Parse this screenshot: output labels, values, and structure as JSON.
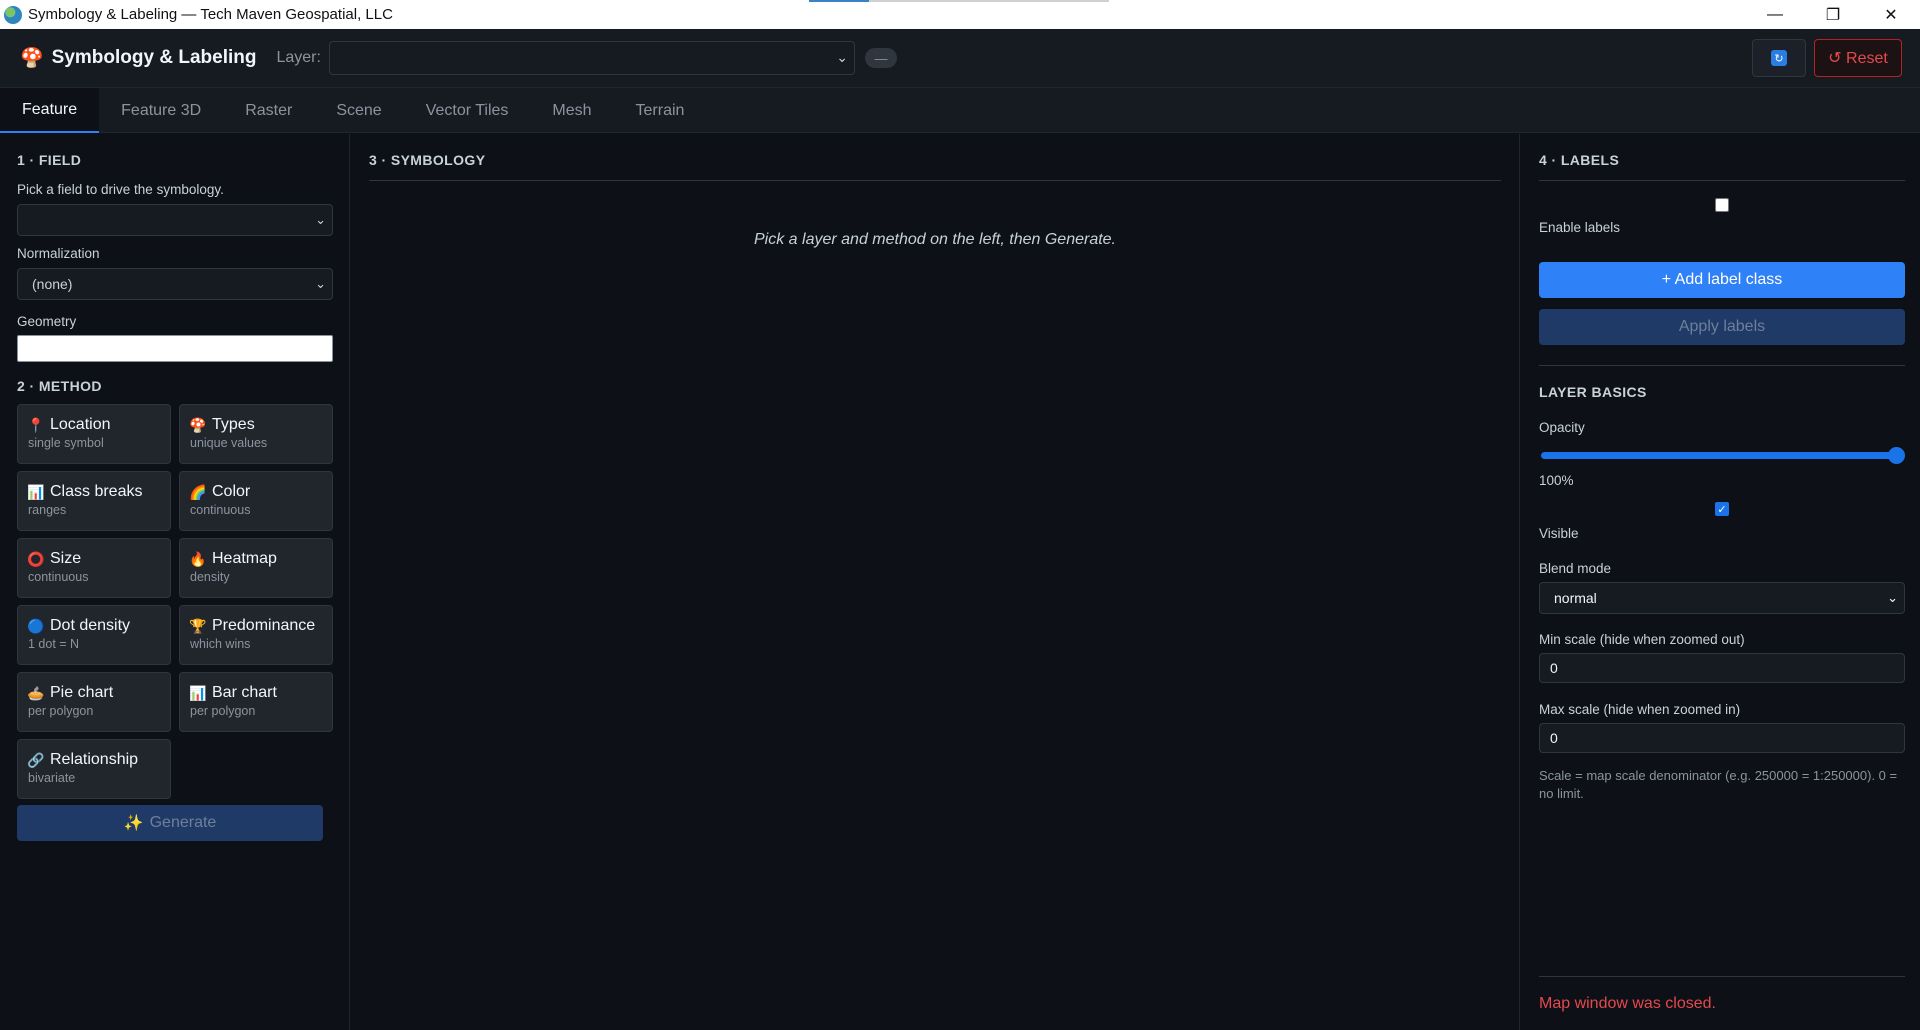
{
  "window": {
    "title": "Symbology & Labeling — Tech Maven Geospatial, LLC",
    "minimize": "—",
    "maximize": "❐",
    "close": "✕"
  },
  "header": {
    "logo": "🍄",
    "title": "Symbology & Labeling",
    "layer_label": "Layer:",
    "layer_value": "",
    "layer_badge": "—",
    "refresh_icon": "↻",
    "reset_label": "↺ Reset"
  },
  "tabs": [
    "Feature",
    "Feature 3D",
    "Raster",
    "Scene",
    "Vector Tiles",
    "Mesh",
    "Terrain"
  ],
  "active_tab": "Feature",
  "left": {
    "field_title": "1 · FIELD",
    "field_hint": "Pick a field to drive the symbology.",
    "field_value": "",
    "normalization_label": "Normalization",
    "normalization_value": "(none)",
    "geometry_label": "Geometry",
    "geometry_value": "",
    "method_title": "2 · METHOD",
    "methods": [
      {
        "icon": "📍",
        "title": "Location",
        "sub": "single symbol"
      },
      {
        "icon": "🍄",
        "title": "Types",
        "sub": "unique values"
      },
      {
        "icon": "📊",
        "title": "Class breaks",
        "sub": "ranges"
      },
      {
        "icon": "🌈",
        "title": "Color",
        "sub": "continuous"
      },
      {
        "icon": "⭕",
        "title": "Size",
        "sub": "continuous"
      },
      {
        "icon": "🔥",
        "title": "Heatmap",
        "sub": "density"
      },
      {
        "icon": "🔵",
        "title": "Dot density",
        "sub": "1 dot = N"
      },
      {
        "icon": "🏆",
        "title": "Predominance",
        "sub": "which wins"
      },
      {
        "icon": "🥧",
        "title": "Pie chart",
        "sub": "per polygon"
      },
      {
        "icon": "📊",
        "title": "Bar chart",
        "sub": "per polygon"
      },
      {
        "icon": "🔗",
        "title": "Relationship",
        "sub": "bivariate"
      }
    ],
    "generate_icon": "✨",
    "generate_label": "Generate"
  },
  "middle": {
    "title": "3 · SYMBOLOGY",
    "placeholder": "Pick a layer and method on the left, then Generate."
  },
  "right": {
    "labels_title": "4 · LABELS",
    "enable_labels": "Enable labels",
    "add_label_class": "+ Add label class",
    "apply_labels": "Apply labels",
    "basics_title": "LAYER BASICS",
    "opacity_label": "Opacity",
    "opacity_value": "100%",
    "opacity_fraction": 1.0,
    "visible_label": "Visible",
    "visible_checked": true,
    "blend_label": "Blend mode",
    "blend_value": "normal",
    "min_scale_label": "Min scale (hide when zoomed out)",
    "min_scale_value": "0",
    "max_scale_label": "Max scale (hide when zoomed in)",
    "max_scale_value": "0",
    "scale_note": "Scale = map scale denominator (e.g. 250000 = 1:250000). 0 = no limit.",
    "status": "Map window was closed."
  },
  "colors": {
    "accent": "#2f81f7",
    "danger": "#e5484d",
    "background": "#0d1117"
  }
}
